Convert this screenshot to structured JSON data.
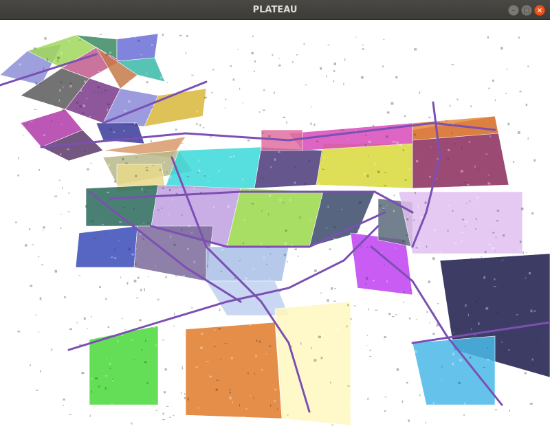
{
  "window": {
    "title": "PLATEAU",
    "controls": {
      "minimize_icon": "minimize-icon",
      "maximize_icon": "maximize-icon",
      "close_icon": "close-icon",
      "minimize_glyph": "–",
      "maximize_glyph": "□",
      "close_glyph": "×"
    }
  },
  "viewport": {
    "content": "3d-city-model",
    "background": "#ffffff",
    "road_color": "#7b4fb3",
    "tile_colors": [
      "#8d8fd8",
      "#a0d85a",
      "#3a8a64",
      "#6a6fd6",
      "#5a5a5a",
      "#c05a8c",
      "#c57a4a",
      "#3ab8a8",
      "#b03aa8",
      "#7a3a8a",
      "#8a8ad8",
      "#d8b63a",
      "#3a3a9a",
      "#5a3a6a",
      "#d89a6a",
      "#b8b88a",
      "#e8d88a",
      "#3ad8d8",
      "#4a3a7a",
      "#d8d83a",
      "#8a2a5a",
      "#d84ab8",
      "#e8883a",
      "#2a6a5a",
      "#bfa0e0",
      "#9ad84a",
      "#3a4a6a",
      "#3a4ab8",
      "#7a6a9a",
      "#aac0e8",
      "#c0d0f0",
      "#4ad83a",
      "#e07a2a",
      "#fff8c0",
      "#c040f0",
      "#5a6a7a",
      "#1a1a4a",
      "#4ab8e8",
      "#e0c0f0",
      "#e070a0"
    ]
  }
}
